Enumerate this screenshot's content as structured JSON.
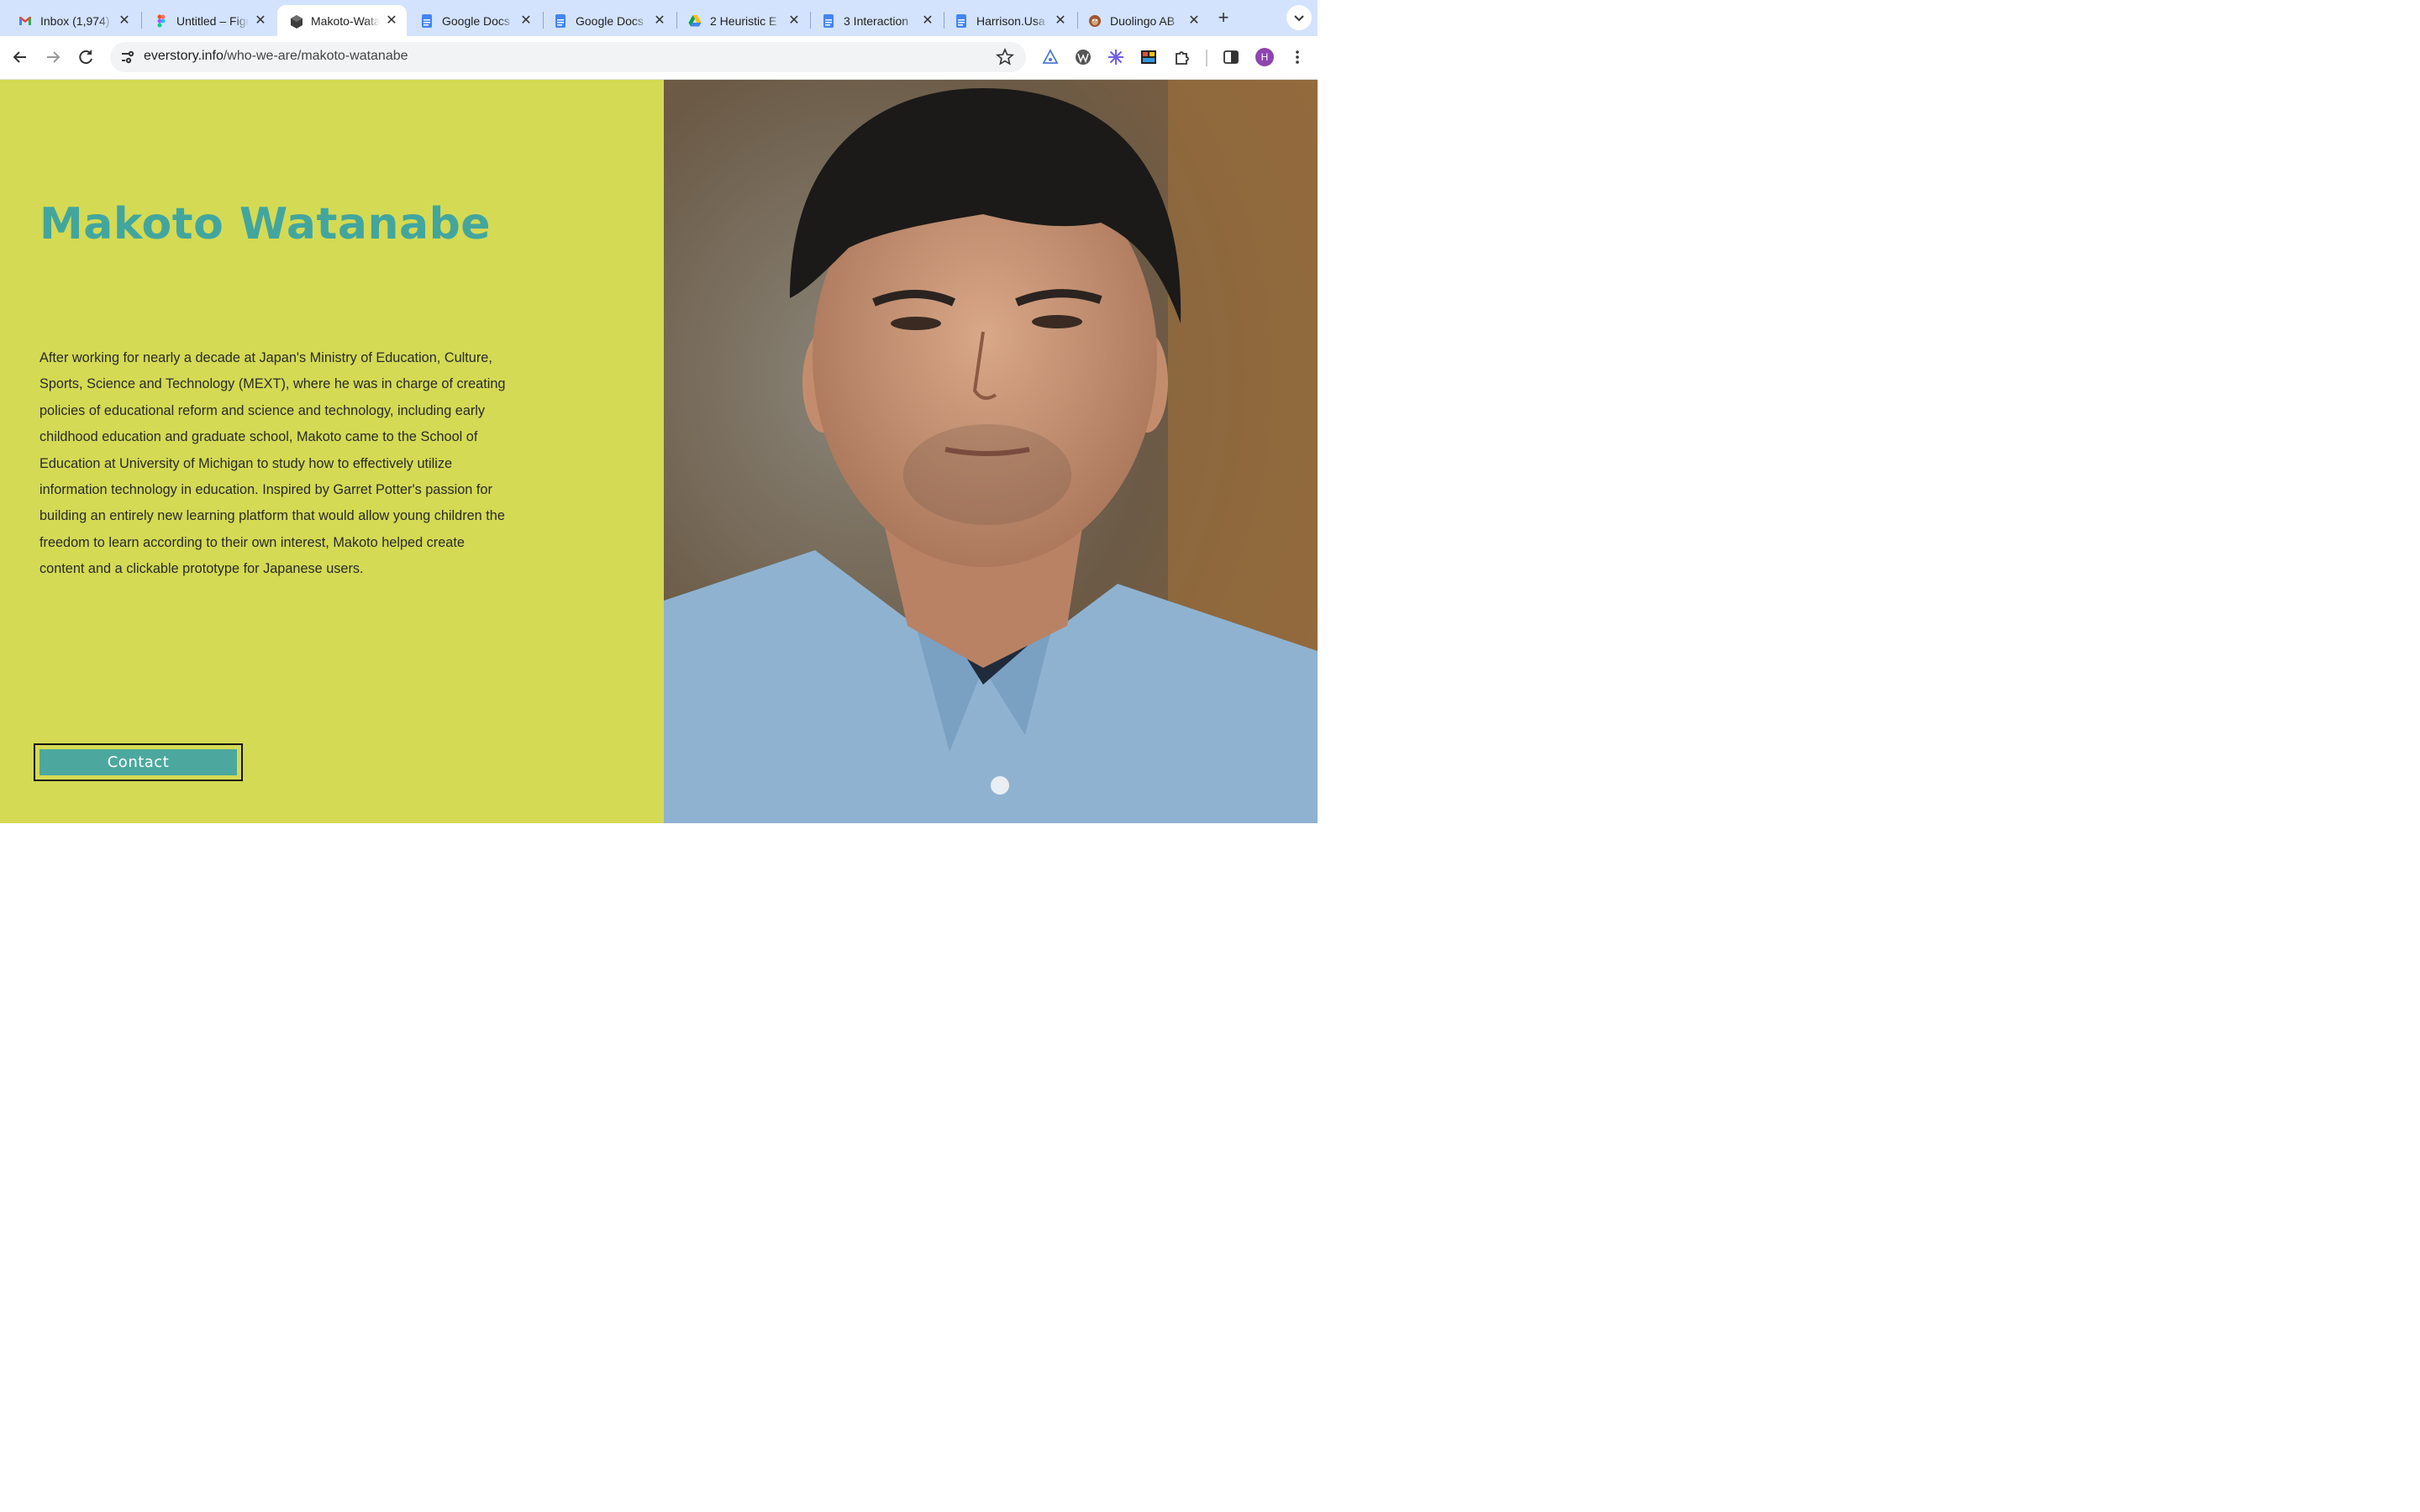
{
  "tabs": [
    {
      "title": "Inbox (1,974)",
      "icon": "gmail-icon",
      "active": false
    },
    {
      "title": "Untitled – Figma",
      "icon": "figma-icon",
      "active": false
    },
    {
      "title": "Makoto-Watanabe",
      "icon": "cube-icon",
      "active": true
    },
    {
      "title": "Google Docs",
      "icon": "docs-icon",
      "active": false
    },
    {
      "title": "Google Docs",
      "icon": "docs-icon",
      "active": false
    },
    {
      "title": "2 Heuristic E",
      "icon": "drive-icon",
      "active": false
    },
    {
      "title": "3 Interaction",
      "icon": "docs-icon",
      "active": false
    },
    {
      "title": "Harrison.Usa",
      "icon": "docs-icon",
      "active": false
    },
    {
      "title": "Duolingo AB",
      "icon": "duolingo-icon",
      "active": false
    }
  ],
  "toolbar": {
    "url_host": "everstory.info",
    "url_path": "/who-we-are/makoto-watanabe",
    "profile_initial": "H"
  },
  "page": {
    "name": "Makoto Watanabe",
    "bio": "After working for nearly a decade at Japan's Ministry of Education, Culture, Sports, Science and Technology (MEXT), where he was in charge of creating policies of educational reform and science and technology, including early childhood education and graduate school, Makoto came to the School of Education at University of Michigan to study how to effectively utilize information technology in education. Inspired by Garret Potter's passion for building an entirely new learning platform that would allow young children the freedom to learn according to their own interest, Makoto helped create content and a clickable prototype for Japanese users.",
    "contact_label": "Contact"
  },
  "colors": {
    "panel_bg": "#d4da54",
    "name_color": "#42a69e",
    "button_bg": "#4ca89f",
    "tabstrip_bg": "#d3e3fd"
  }
}
